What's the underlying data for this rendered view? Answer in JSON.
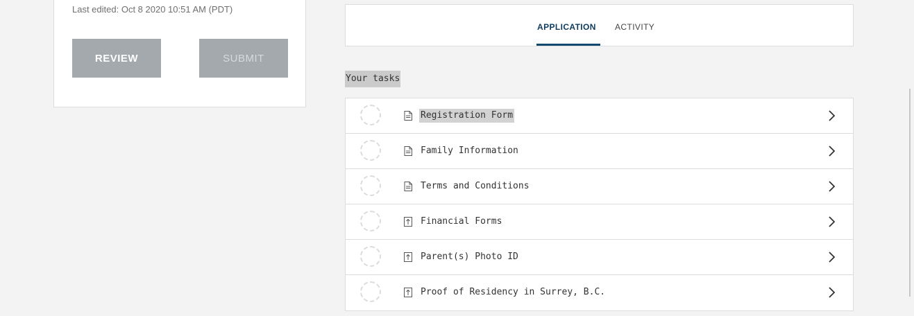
{
  "left_card": {
    "last_edited": "Last edited: Oct 8 2020 10:51 AM (PDT)",
    "review_label": "REVIEW",
    "submit_label": "SUBMIT"
  },
  "tabs": {
    "application": "APPLICATION",
    "activity": "ACTIVITY",
    "active": "APPLICATION"
  },
  "tasks_heading": "Your tasks",
  "tasks": [
    {
      "label": "Registration Form",
      "icon": "document-icon",
      "highlighted": true
    },
    {
      "label": "Family Information",
      "icon": "document-icon"
    },
    {
      "label": "Terms and Conditions",
      "icon": "document-icon"
    },
    {
      "label": "Financial Forms",
      "icon": "upload-icon"
    },
    {
      "label": "Parent(s) Photo ID",
      "icon": "upload-icon"
    },
    {
      "label": "Proof of Residency in Surrey, B.C.",
      "icon": "upload-icon"
    }
  ],
  "colors": {
    "accent": "#12496f",
    "button": "#a3a9ad",
    "background": "#f3f3f3"
  }
}
